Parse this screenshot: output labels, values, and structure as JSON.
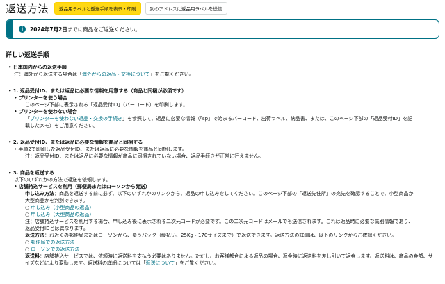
{
  "header": {
    "title": "返送方法",
    "tab_active": "返品用ラベルと返送手順を表示・印刷",
    "tab_inactive": "別のアドレスに返品用ラベルを送信"
  },
  "alert": {
    "date": "2024年7月2日",
    "text_after": "までに商品をご返送ください。"
  },
  "section_title": "詳しい返送手順",
  "domestic": {
    "title": "日本国内からの返送手順",
    "note_before": "注：海外から返送する場合は「",
    "note_link": "海外からの返品・交換について",
    "note_after": "」をご覧ください。"
  },
  "step1": {
    "title": "1. 返品受付ID、または返品に必要な情報を用意する（商品と同梱が必須です）",
    "printer_title": "プリンターを使う場合",
    "printer_text": "このページ下部に表示される「返品受付ID」（バーコード）を印刷します。",
    "no_printer_title": "プリンターを使わない場合",
    "no_printer_before": "「",
    "no_printer_link": "プリンターを使わない返品・交換の手続き",
    "no_printer_after": "」を参照して、返品に必要な情報（「sp」で始まるバーコード、出荷ラベル、納品書、または、このページ下部の「返品受付ID」を記",
    "no_printer_after2": "載したメモ）をご用意ください。"
  },
  "step2": {
    "title": "2. 返品受付ID、または返品に必要な情報を商品と同梱する",
    "text1": "手順2で印刷した返品受付ID、または返品に必要な情報を商品と同梱します。",
    "text2": "注：返品受付ID、または返品に必要な情報が商品に同梱されていない場合、返品手続きが正常に行えません。"
  },
  "step3": {
    "title": "3. 商品を返送する",
    "intro": "以下のいずれかの方法で返送を依頼します。",
    "store_title": "店舗持込サービスを利用（郵便局またはローソンから発送）",
    "apply_label": "申し込み方法",
    "apply_text": "：商品を返送する前に必ず、以下のいずれかのリンクから、返品の申し込みをしてください。このページ下部の「返送先住所」の宛先を確認することで、小型商品か",
    "apply_text2": "大型商品かを判別できます。",
    "link_small": "申し込み（小型商品の返品）",
    "link_large": "申し込み（大型商品の返品）",
    "note1": "注：店舗持込サービスを利用する場合、申し込み後に表示される二次元コードが必要です。この二次元コードはメールでも送信されます。これは返品時に必要な識別情報であり、",
    "note2": "返品受付IDとは異なります。",
    "method_label": "返送方法",
    "method_text": "：お近くの郵便局またはローソンから、ゆうパック（縦払い、25Kg・170サイズまで）で返送できます。返送方法の詳細は、以下のリンクからご確認ください。",
    "link_post": "郵便局での返送方法",
    "link_lawson": "ローソンでの返送方法",
    "fee_label": "返送料",
    "fee_text": "：店舗持込サービスでは、依頼時に返送料を支払う必要はありません。ただし、お客様都合による返品の場合、返金時に返送料を差し引いて返金します。返送料は、商品の金額、サ",
    "fee_text2_before": "イズなどにより変動します。返送料の詳細については「",
    "fee_link": "返送について",
    "fee_text2_after": "」をご覧ください。"
  },
  "colors": {
    "link": "#007185",
    "accent": "#ffd814",
    "alert_border": "#007185"
  }
}
